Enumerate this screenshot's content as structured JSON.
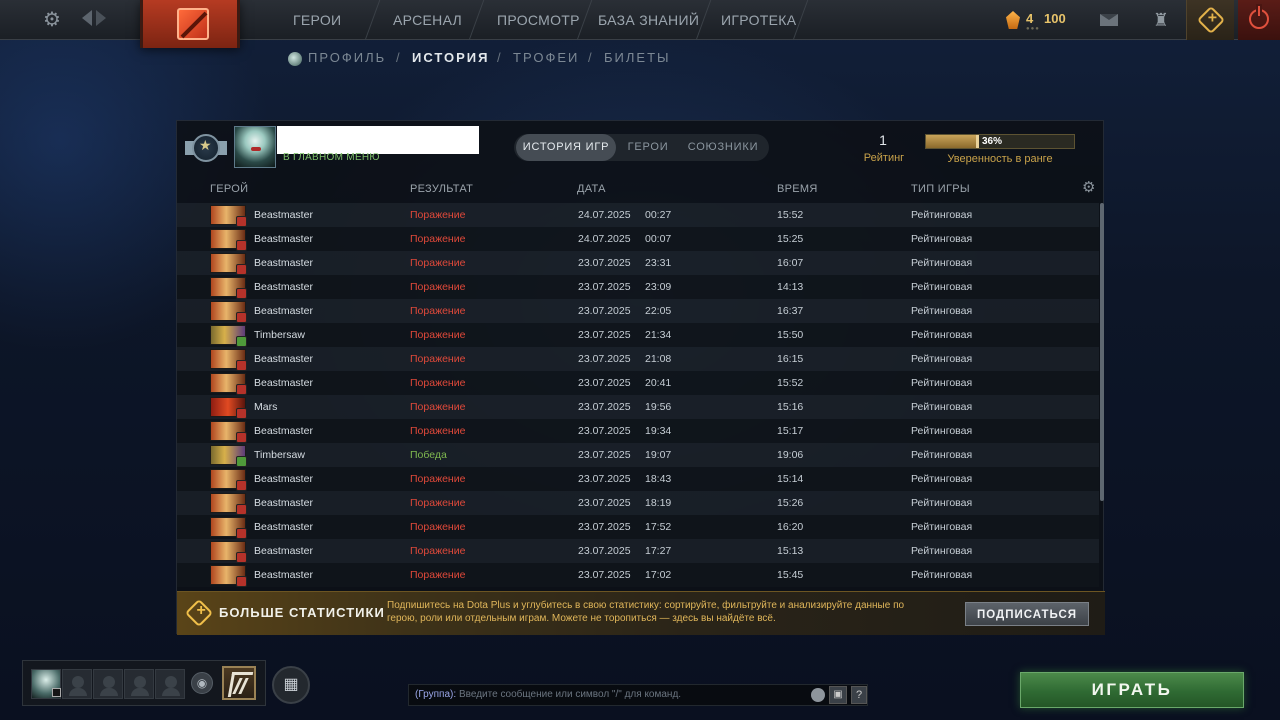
{
  "topbar": {
    "nav": [
      "ГЕРОИ",
      "АРСЕНАЛ",
      "ПРОСМОТР",
      "БАЗА ЗНАНИЙ",
      "ИГРОТЕКА"
    ],
    "shard_count": "4",
    "coins": "100",
    "icons": [
      "gear-icon",
      "back-arrow-icon",
      "forward-arrow-icon",
      "dota-logo-icon",
      "mail-icon",
      "armory-icon",
      "dota-plus-icon",
      "power-icon"
    ]
  },
  "subnav": {
    "profile": "ПРОФИЛЬ",
    "history": "ИСТОРИЯ",
    "trophies": "ТРОФЕИ",
    "tickets": "БИЛЕТЫ",
    "sep": "/"
  },
  "profile": {
    "status": "В ГЛАВНОМ МЕНЮ"
  },
  "tabs": [
    "ИСТОРИЯ ИГР",
    "ГЕРОИ",
    "СОЮЗНИКИ"
  ],
  "rank": {
    "rating": "1",
    "rating_label": "Рейтинг",
    "confidence_percent": 36,
    "confidence_text": "36%",
    "confidence_label": "Уверенность в ранге"
  },
  "columns": {
    "hero": "ГЕРОЙ",
    "result": "РЕЗУЛЬТАТ",
    "date": "ДАТА",
    "duration": "ВРЕМЯ",
    "type": "ТИП ИГРЫ"
  },
  "matches": [
    {
      "hero": "Beastmaster",
      "result": "Поражение",
      "win": false,
      "date": "24.07.2025",
      "time": "00:27",
      "duration": "15:52",
      "type": "Рейтинговая"
    },
    {
      "hero": "Beastmaster",
      "result": "Поражение",
      "win": false,
      "date": "24.07.2025",
      "time": "00:07",
      "duration": "15:25",
      "type": "Рейтинговая"
    },
    {
      "hero": "Beastmaster",
      "result": "Поражение",
      "win": false,
      "date": "23.07.2025",
      "time": "23:31",
      "duration": "16:07",
      "type": "Рейтинговая"
    },
    {
      "hero": "Beastmaster",
      "result": "Поражение",
      "win": false,
      "date": "23.07.2025",
      "time": "23:09",
      "duration": "14:13",
      "type": "Рейтинговая"
    },
    {
      "hero": "Beastmaster",
      "result": "Поражение",
      "win": false,
      "date": "23.07.2025",
      "time": "22:05",
      "duration": "16:37",
      "type": "Рейтинговая"
    },
    {
      "hero": "Timbersaw",
      "result": "Поражение",
      "win": false,
      "date": "23.07.2025",
      "time": "21:34",
      "duration": "15:50",
      "type": "Рейтинговая"
    },
    {
      "hero": "Beastmaster",
      "result": "Поражение",
      "win": false,
      "date": "23.07.2025",
      "time": "21:08",
      "duration": "16:15",
      "type": "Рейтинговая"
    },
    {
      "hero": "Beastmaster",
      "result": "Поражение",
      "win": false,
      "date": "23.07.2025",
      "time": "20:41",
      "duration": "15:52",
      "type": "Рейтинговая"
    },
    {
      "hero": "Mars",
      "result": "Поражение",
      "win": false,
      "date": "23.07.2025",
      "time": "19:56",
      "duration": "15:16",
      "type": "Рейтинговая"
    },
    {
      "hero": "Beastmaster",
      "result": "Поражение",
      "win": false,
      "date": "23.07.2025",
      "time": "19:34",
      "duration": "15:17",
      "type": "Рейтинговая"
    },
    {
      "hero": "Timbersaw",
      "result": "Победа",
      "win": true,
      "date": "23.07.2025",
      "time": "19:07",
      "duration": "19:06",
      "type": "Рейтинговая"
    },
    {
      "hero": "Beastmaster",
      "result": "Поражение",
      "win": false,
      "date": "23.07.2025",
      "time": "18:43",
      "duration": "15:14",
      "type": "Рейтинговая"
    },
    {
      "hero": "Beastmaster",
      "result": "Поражение",
      "win": false,
      "date": "23.07.2025",
      "time": "18:19",
      "duration": "15:26",
      "type": "Рейтинговая"
    },
    {
      "hero": "Beastmaster",
      "result": "Поражение",
      "win": false,
      "date": "23.07.2025",
      "time": "17:52",
      "duration": "16:20",
      "type": "Рейтинговая"
    },
    {
      "hero": "Beastmaster",
      "result": "Поражение",
      "win": false,
      "date": "23.07.2025",
      "time": "17:27",
      "duration": "15:13",
      "type": "Рейтинговая"
    },
    {
      "hero": "Beastmaster",
      "result": "Поражение",
      "win": false,
      "date": "23.07.2025",
      "time": "17:02",
      "duration": "15:45",
      "type": "Рейтинговая"
    }
  ],
  "plus_banner": {
    "title": "БОЛЬШЕ СТАТИСТИКИ",
    "text": "Подпишитесь на Dota Plus и углубитесь в свою статистику: сортируйте, фильтруйте и анализируйте данные по герою, роли или отдельным играм. Можете не торопиться — здесь вы найдёте всё.",
    "button": "ПОДПИСАТЬСЯ"
  },
  "chat": {
    "channel": "(Группа):",
    "placeholder": "Введите сообщение или символ \"/\" для команд."
  },
  "play_button": "ИГРАТЬ",
  "colors": {
    "loss": "#e0493a",
    "win": "#7fb84f",
    "gold": "#c8a24a",
    "play": "#2f6a33"
  }
}
